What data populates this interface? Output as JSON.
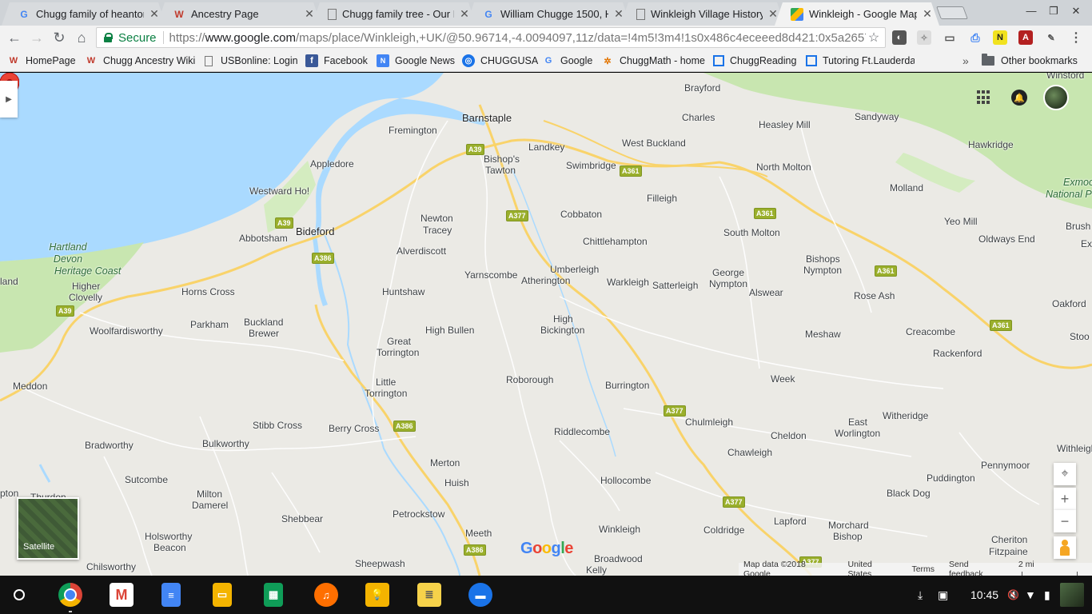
{
  "browser": {
    "tabs": [
      {
        "title": "Chugg family of heanton",
        "icon": "google-icon",
        "active": false
      },
      {
        "title": "Ancestry Page",
        "icon": "ancestry-wiki-icon",
        "active": false
      },
      {
        "title": "Chugg family tree - Our D",
        "icon": "page-icon",
        "active": false
      },
      {
        "title": "William Chugge 1500, H",
        "icon": "google-icon",
        "active": false
      },
      {
        "title": "Winkleigh Village History",
        "icon": "page-icon",
        "active": false
      },
      {
        "title": "Winkleigh - Google Maps",
        "icon": "google-maps-icon",
        "active": true
      }
    ],
    "close_glyph": "✕",
    "omnibox": {
      "secure_label": "Secure",
      "url_scheme": "https://",
      "url_host": "www.google.com",
      "url_path": "/maps/place/Winkleigh,+UK/@50.96714,-4.0094097,11z/data=!4m5!3m4!1s0x486c4eceeed8d421:0x5a265719f..."
    },
    "bookmarks": [
      {
        "label": "HomePage",
        "icon": "ancestry-wiki-icon"
      },
      {
        "label": "Chugg Ancestry Wiki",
        "icon": "ancestry-wiki-icon"
      },
      {
        "label": "USBonline: Login",
        "icon": "page-icon"
      },
      {
        "label": "Facebook",
        "icon": "facebook-icon"
      },
      {
        "label": "Google News",
        "icon": "google-news-icon"
      },
      {
        "label": "CHUGGUSA",
        "icon": "globe-icon"
      },
      {
        "label": "Google",
        "icon": "google-icon"
      },
      {
        "label": "ChuggMath - home",
        "icon": "pinwheel-icon"
      },
      {
        "label": "ChuggReading",
        "icon": "site-icon"
      },
      {
        "label": "Tutoring Ft.Lauderda",
        "icon": "site-icon"
      }
    ],
    "overflow_glyph": "»",
    "other_bookmarks": "Other bookmarks"
  },
  "map": {
    "places": [
      {
        "name": "Brayford"
      },
      {
        "name": "Winstord"
      },
      {
        "name": "Charles"
      },
      {
        "name": "Heasley Mill"
      },
      {
        "name": "Sandyway"
      },
      {
        "name": "Barnstaple"
      },
      {
        "name": "Fremington"
      },
      {
        "name": "Landkey"
      },
      {
        "name": "West Buckland"
      },
      {
        "name": "Hawkridge"
      },
      {
        "name": "Appledore"
      },
      {
        "name": "Bishop's"
      },
      {
        "name": "Tawton"
      },
      {
        "name": "Swimbridge"
      },
      {
        "name": "North Molton"
      },
      {
        "name": "Exmoo"
      },
      {
        "name": "National P"
      },
      {
        "name": "Westward Ho!"
      },
      {
        "name": "Filleigh"
      },
      {
        "name": "Molland"
      },
      {
        "name": "Newton"
      },
      {
        "name": "Tracey"
      },
      {
        "name": "Cobbaton"
      },
      {
        "name": "Yeo Mill"
      },
      {
        "name": "Brush"
      },
      {
        "name": "Oldways End"
      },
      {
        "name": "Ex"
      },
      {
        "name": "Abbotsham"
      },
      {
        "name": "Bideford"
      },
      {
        "name": "Chittlehampton"
      },
      {
        "name": "South Molton"
      },
      {
        "name": "Hartland"
      },
      {
        "name": "Devon"
      },
      {
        "name": "Heritage Coast"
      },
      {
        "name": "Alverdiscott"
      },
      {
        "name": "Bishops"
      },
      {
        "name": "Nympton"
      },
      {
        "name": "Umberleigh"
      },
      {
        "name": "Yarnscombe"
      },
      {
        "name": "Atherington"
      },
      {
        "name": "George"
      },
      {
        "name": "Nympton"
      },
      {
        "name": "land"
      },
      {
        "name": "Higher"
      },
      {
        "name": "Clovelly"
      },
      {
        "name": "Horns Cross"
      },
      {
        "name": "Warkleigh"
      },
      {
        "name": "Satterleigh"
      },
      {
        "name": "Huntshaw"
      },
      {
        "name": "Alswear"
      },
      {
        "name": "Rose Ash"
      },
      {
        "name": "Oakford"
      },
      {
        "name": "Buckland"
      },
      {
        "name": "Brewer"
      },
      {
        "name": "High"
      },
      {
        "name": "Bickington"
      },
      {
        "name": "Woolfardisworthy"
      },
      {
        "name": "Parkham"
      },
      {
        "name": "High Bullen"
      },
      {
        "name": "Meshaw"
      },
      {
        "name": "Creacombe"
      },
      {
        "name": "Stoo"
      },
      {
        "name": "Great"
      },
      {
        "name": "Torrington"
      },
      {
        "name": "Rackenford"
      },
      {
        "name": "Roborough"
      },
      {
        "name": "Week"
      },
      {
        "name": "Meddon"
      },
      {
        "name": "Little"
      },
      {
        "name": "Torrington"
      },
      {
        "name": "Burrington"
      },
      {
        "name": "Witheridge"
      },
      {
        "name": "Stibb Cross"
      },
      {
        "name": "Chulmleigh"
      },
      {
        "name": "East"
      },
      {
        "name": "Worlington"
      },
      {
        "name": "Berry Cross"
      },
      {
        "name": "Riddlecombe"
      },
      {
        "name": "Bradworthy"
      },
      {
        "name": "Bulkworthy"
      },
      {
        "name": "Cheldon"
      },
      {
        "name": "Withleigh"
      },
      {
        "name": "Chawleigh"
      },
      {
        "name": "Merton"
      },
      {
        "name": "Pennymoor"
      },
      {
        "name": "Sutcombe"
      },
      {
        "name": "Huish"
      },
      {
        "name": "Hollocombe"
      },
      {
        "name": "Puddington"
      },
      {
        "name": "Black Dog"
      },
      {
        "name": "Milton"
      },
      {
        "name": "Damerel"
      },
      {
        "name": "pton"
      },
      {
        "name": "Thurdon"
      },
      {
        "name": "Petrockstow"
      },
      {
        "name": "Shebbear"
      },
      {
        "name": "Winkleigh"
      },
      {
        "name": "Coldridge"
      },
      {
        "name": "Lapford"
      },
      {
        "name": "Morchard"
      },
      {
        "name": "Bishop"
      },
      {
        "name": "Meeth"
      },
      {
        "name": "Holsworthy"
      },
      {
        "name": "Beacon"
      },
      {
        "name": "Cheriton"
      },
      {
        "name": "Fitzpaine"
      },
      {
        "name": "Broadwood"
      },
      {
        "name": "Kelly"
      },
      {
        "name": "Sheepwash"
      },
      {
        "name": "Chilsworthy"
      }
    ],
    "road_shields": [
      "A39",
      "A361",
      "A361",
      "A39",
      "A377",
      "A386",
      "A39",
      "A361",
      "A361",
      "A386",
      "A377",
      "A377",
      "A386",
      "A377"
    ],
    "satellite_label": "Satellite",
    "google_logo": "Google",
    "footer": {
      "map_data": "Map data ©2018 Google",
      "region": "United States",
      "terms": "Terms",
      "feedback": "Send feedback",
      "scale": "2 mi"
    },
    "controls": {
      "zoom_in": "+",
      "zoom_out": "−"
    },
    "selected_place": "Winkleigh"
  },
  "shelf": {
    "apps": [
      "chrome",
      "gmail",
      "docs",
      "slides",
      "sheets",
      "play-music",
      "keep",
      "notes",
      "files"
    ],
    "time": "10:45"
  },
  "colors": {
    "land": "#ebeae5",
    "water": "#aadaff",
    "park": "#c8e6b0",
    "road_major": "#f9d36a",
    "pin": "#ea4335"
  }
}
